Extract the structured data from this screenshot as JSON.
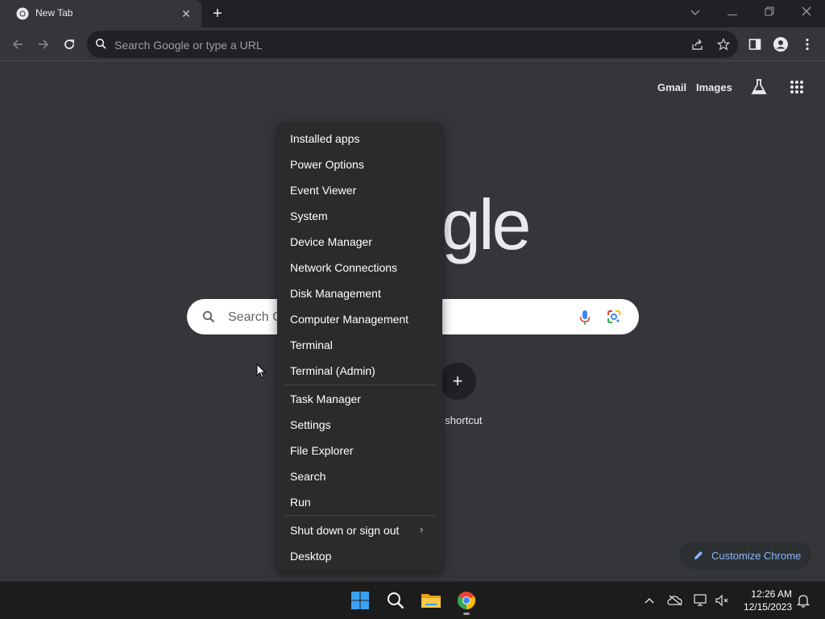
{
  "browser": {
    "tab": {
      "title": "New Tab",
      "close_icon": "close-icon",
      "favicon": "chrome-icon"
    },
    "window_controls": [
      "chevron-down-icon",
      "minimize-icon",
      "restore-icon",
      "close-icon"
    ],
    "omnibox": {
      "placeholder": "Search Google or type a URL"
    }
  },
  "ntp": {
    "gmail": "Gmail",
    "images": "Images",
    "logo_text": "gle",
    "search_placeholder": "Search G",
    "shortcut_label": "d shortcut",
    "customize": "Customize Chrome"
  },
  "menu": {
    "group1": [
      "Installed apps",
      "Power Options",
      "Event Viewer",
      "System",
      "Device Manager",
      "Network Connections",
      "Disk Management",
      "Computer Management",
      "Terminal",
      "Terminal (Admin)"
    ],
    "group2": [
      "Task Manager",
      "Settings",
      "File Explorer",
      "Search",
      "Run"
    ],
    "group3": [
      "Shut down or sign out",
      "Desktop"
    ]
  },
  "taskbar": {
    "time": "12:26 AM",
    "date": "12/15/2023",
    "apps": [
      "windows-start-icon",
      "search-icon",
      "file-explorer-icon",
      "chrome-icon"
    ]
  },
  "colors": {
    "background": "#35363a",
    "menu_background": "#2b2b2b",
    "accent_blue": "#8ab4f8"
  }
}
